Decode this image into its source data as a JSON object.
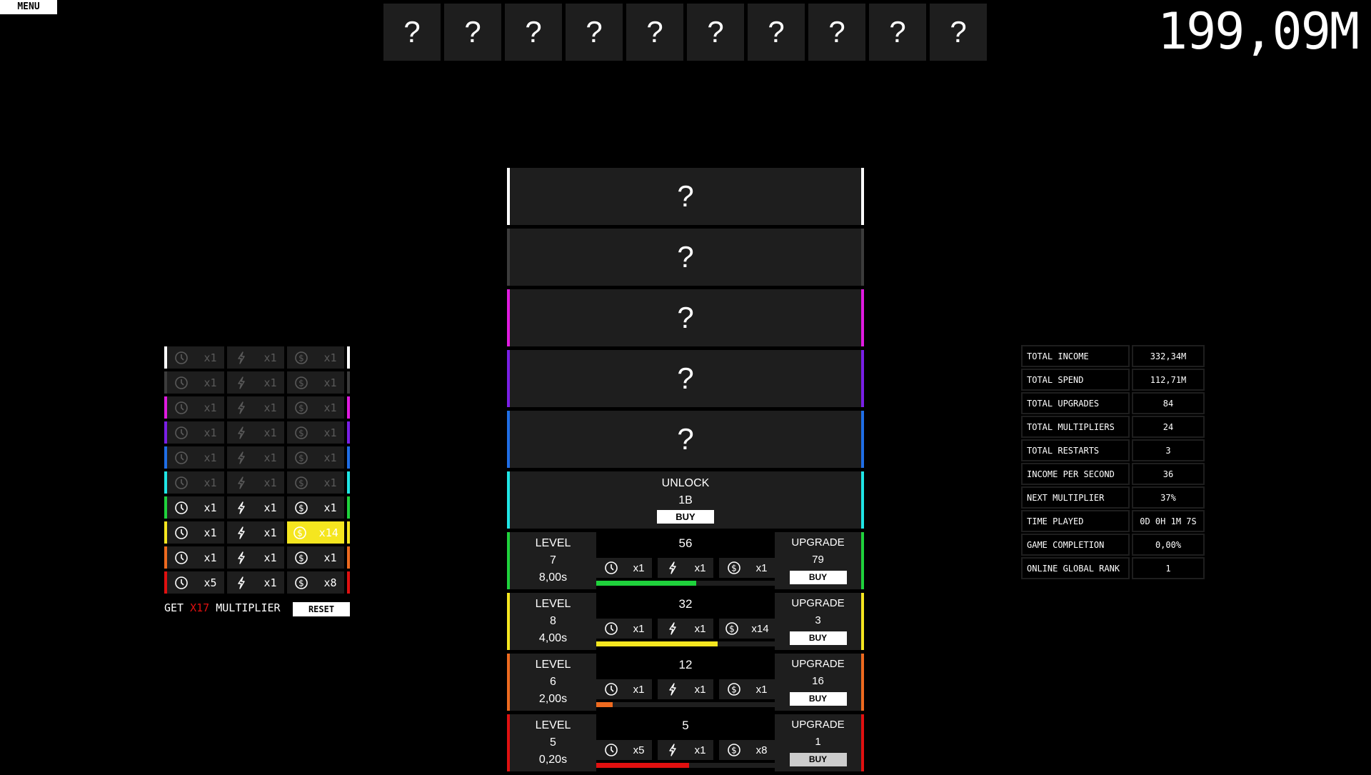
{
  "menu_label": "MENU",
  "money": "199,09M",
  "top_slots": [
    "?",
    "?",
    "?",
    "?",
    "?",
    "?",
    "?",
    "?",
    "?",
    "?"
  ],
  "colors": {
    "white": "#ffffff",
    "gray": "#3c3c3c",
    "magenta": "#e01be0",
    "purple": "#7a1fe6",
    "blue": "#1f6ee6",
    "cyan": "#1fe6e6",
    "green": "#1fd23c",
    "yellow": "#f5e61f",
    "orange": "#ee6a1f",
    "red": "#e01010",
    "panel": "#1e1e1e"
  },
  "locked_generators": [
    {
      "label": "?",
      "color": "#ffffff"
    },
    {
      "label": "?",
      "color": "#3c3c3c"
    },
    {
      "label": "?",
      "color": "#e01be0"
    },
    {
      "label": "?",
      "color": "#7a1fe6"
    },
    {
      "label": "?",
      "color": "#1f6ee6"
    }
  ],
  "unlock": {
    "title": "UNLOCK",
    "cost": "1B",
    "buy_label": "BUY",
    "color": "#1fe6e6"
  },
  "generators": [
    {
      "level_label": "LEVEL",
      "level": "7",
      "time": "8,00s",
      "count": "56",
      "speed": "x1",
      "power": "x1",
      "money": "x1",
      "progress": 0.56,
      "upgrade_label": "UPGRADE",
      "upgrade_cost": "79",
      "buy_label": "BUY",
      "color": "#1fd23c"
    },
    {
      "level_label": "LEVEL",
      "level": "8",
      "time": "4,00s",
      "count": "32",
      "speed": "x1",
      "power": "x1",
      "money": "x14",
      "progress": 0.68,
      "upgrade_label": "UPGRADE",
      "upgrade_cost": "3",
      "buy_label": "BUY",
      "color": "#f5e61f"
    },
    {
      "level_label": "LEVEL",
      "level": "6",
      "time": "2,00s",
      "count": "12",
      "speed": "x1",
      "power": "x1",
      "money": "x1",
      "progress": 0.09,
      "upgrade_label": "UPGRADE",
      "upgrade_cost": "16",
      "buy_label": "BUY",
      "color": "#ee6a1f"
    },
    {
      "level_label": "LEVEL",
      "level": "5",
      "time": "0,20s",
      "count": "5",
      "speed": "x5",
      "power": "x1",
      "money": "x8",
      "progress": 0.52,
      "upgrade_label": "UPGRADE",
      "upgrade_cost": "1",
      "buy_label": "BUY",
      "color": "#e01010"
    }
  ],
  "multiplier_table": [
    {
      "color": "#ffffff",
      "dim": true,
      "speed": "x1",
      "power": "x1",
      "money": "x1"
    },
    {
      "color": "#3c3c3c",
      "dim": true,
      "speed": "x1",
      "power": "x1",
      "money": "x1"
    },
    {
      "color": "#e01be0",
      "dim": true,
      "speed": "x1",
      "power": "x1",
      "money": "x1"
    },
    {
      "color": "#7a1fe6",
      "dim": true,
      "speed": "x1",
      "power": "x1",
      "money": "x1"
    },
    {
      "color": "#1f6ee6",
      "dim": true,
      "speed": "x1",
      "power": "x1",
      "money": "x1"
    },
    {
      "color": "#1fe6e6",
      "dim": true,
      "speed": "x1",
      "power": "x1",
      "money": "x1"
    },
    {
      "color": "#1fd23c",
      "dim": false,
      "speed": "x1",
      "power": "x1",
      "money": "x1"
    },
    {
      "color": "#f5e61f",
      "dim": false,
      "speed": "x1",
      "power": "x1",
      "money": "x14",
      "highlight_money": true
    },
    {
      "color": "#ee6a1f",
      "dim": false,
      "speed": "x1",
      "power": "x1",
      "money": "x1"
    },
    {
      "color": "#e01010",
      "dim": false,
      "speed": "x5",
      "power": "x1",
      "money": "x8"
    }
  ],
  "get_multiplier": {
    "prefix": "GET ",
    "value": "X17",
    "suffix": " MULTIPLIER",
    "reset_label": "RESET"
  },
  "stats": [
    {
      "label": "TOTAL INCOME",
      "value": "332,34M"
    },
    {
      "label": "TOTAL SPEND",
      "value": "112,71M"
    },
    {
      "label": "TOTAL UPGRADES",
      "value": "84"
    },
    {
      "label": "TOTAL MULTIPLIERS",
      "value": "24"
    },
    {
      "label": "TOTAL RESTARTS",
      "value": "3"
    },
    {
      "label": "INCOME PER SECOND",
      "value": "36"
    },
    {
      "label": "NEXT MULTIPLIER",
      "value": "37%"
    },
    {
      "label": "TIME PLAYED",
      "value": "0D 0H 1M 7S"
    },
    {
      "label": "GAME COMPLETION",
      "value": "0,00%"
    },
    {
      "label": "ONLINE GLOBAL RANK",
      "value": "1"
    }
  ]
}
